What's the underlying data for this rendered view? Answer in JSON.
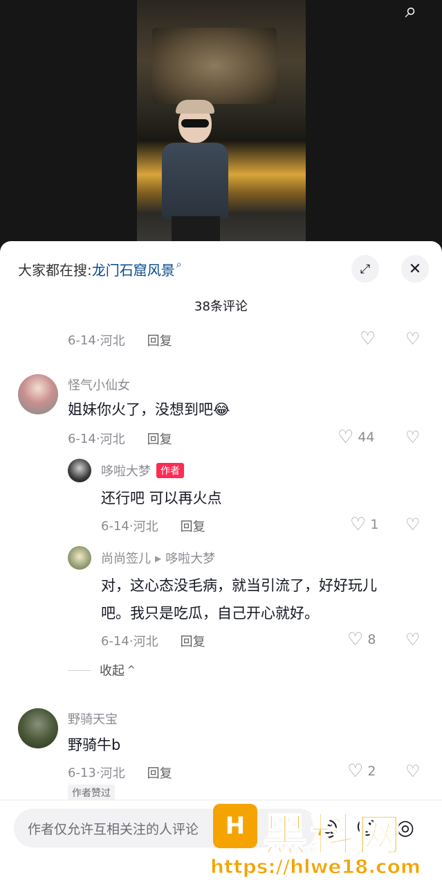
{
  "header": {
    "search_icon": "search-icon"
  },
  "search_bar": {
    "prefix": "大家都在搜:",
    "link": "龙门石窟风景"
  },
  "comment_count": "38条评论",
  "comments": [
    {
      "meta": {
        "date": "6-14",
        "location": "河北",
        "reply": "回复"
      },
      "likes": ""
    },
    {
      "user": "怪气小仙女",
      "text": "姐妹你火了，没想到吧😂",
      "meta": {
        "date": "6-14",
        "location": "河北",
        "reply": "回复"
      },
      "likes": "44",
      "replies": [
        {
          "user": "哆啦大梦",
          "badge": "作者",
          "text": "还行吧 可以再火点",
          "meta": {
            "date": "6-14",
            "location": "河北",
            "reply": "回复"
          },
          "likes": "1"
        },
        {
          "user": "尚尚签儿",
          "reply_to": "哆啦大梦",
          "text_line1": "对，这心态没毛病，就当引流了，好好玩儿",
          "text_line2": "吧。我只是吃瓜，自己开心就好。",
          "meta": {
            "date": "6-14",
            "location": "河北",
            "reply": "回复"
          },
          "likes": "8"
        }
      ],
      "collapse": "收起"
    },
    {
      "user": "野骑天宝",
      "text": "野骑牛b",
      "meta": {
        "date": "6-13",
        "location": "河北",
        "reply": "回复"
      },
      "likes": "2",
      "author_liked": "作者赞过"
    }
  ],
  "input": {
    "placeholder": "作者仅允许互相关注的人评论"
  },
  "watermark": {
    "title": "黑料网",
    "url": "https://hlwe18.com"
  }
}
